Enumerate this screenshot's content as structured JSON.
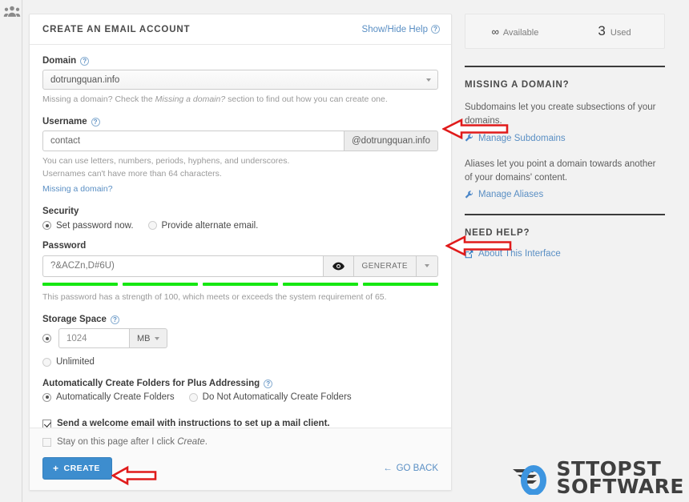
{
  "window": {
    "top_left_icon": "users-group-icon"
  },
  "card": {
    "title": "CREATE AN EMAIL ACCOUNT",
    "help_link": "Show/Hide Help",
    "help_icon": "question-circle-icon"
  },
  "domain": {
    "label": "Domain",
    "help_icon": "question-circle-icon",
    "selected": "dotrungquan.info",
    "caret_icon": "chevron-down-icon",
    "hint_prefix": "Missing a domain? Check the ",
    "hint_italic": "Missing a domain?",
    "hint_suffix": " section to find out how you can create one."
  },
  "username": {
    "label": "Username",
    "help_icon": "question-circle-icon",
    "value": "contact",
    "placeholder": "contact",
    "addon": "@dotrungquan.info",
    "hint_line1": "You can use letters, numbers, periods, hyphens, and underscores.",
    "hint_line2": "Usernames can't have more than 64 characters.",
    "missing_domain_link": "Missing a domain?"
  },
  "security": {
    "title": "Security",
    "options": [
      {
        "label": "Set password now.",
        "selected": true
      },
      {
        "label": "Provide alternate email.",
        "selected": false
      }
    ]
  },
  "password": {
    "label": "Password",
    "value": "?&ACZn,D#6U)",
    "placeholder": "Password",
    "eye_icon": "eye-icon",
    "generate_label": "GENERATE",
    "caret_icon": "chevron-down-icon",
    "strength_segments": 5,
    "strength_color": "#15e712",
    "strength_text": "This password has a strength of 100, which meets or exceeds the system requirement of 65."
  },
  "storage": {
    "label": "Storage Space",
    "help_icon": "question-circle-icon",
    "quota_selected": true,
    "value": "1024",
    "unit": "MB",
    "unit_caret_icon": "chevron-down-icon",
    "unlimited_label": "Unlimited",
    "unlimited_selected": false
  },
  "plus_addressing": {
    "label": "Automatically Create Folders for Plus Addressing",
    "help_icon": "question-circle-icon",
    "options": [
      {
        "label": "Automatically Create Folders",
        "selected": true
      },
      {
        "label": "Do Not Automatically Create Folders",
        "selected": false
      }
    ]
  },
  "welcome_email": {
    "label": "Send a welcome email with instructions to set up a mail client.",
    "checked": true
  },
  "footer": {
    "stay_prefix": "Stay on this page after I click ",
    "stay_italic": "Create",
    "stay_suffix": ".",
    "stay_checked": false,
    "create_label": "CREATE",
    "create_icon": "plus-icon",
    "create_color": "#3d8dce",
    "go_back_label": "GO BACK",
    "go_back_icon": "arrow-left-icon"
  },
  "sidebar": {
    "stats": {
      "available_value": "∞",
      "available_label": "Available",
      "used_value": "3",
      "used_label": "Used"
    },
    "missing_domain": {
      "heading": "MISSING A DOMAIN?",
      "paragraph1": "Subdomains let you create subsections of your domains.",
      "link1": "Manage Subdomains",
      "link1_icon": "wrench-icon",
      "paragraph2": "Aliases let you point a domain towards another of your domains' content.",
      "link2": "Manage Aliases",
      "link2_icon": "wrench-icon"
    },
    "need_help": {
      "heading": "NEED HELP?",
      "link": "About This Interface",
      "link_icon": "external-link-icon"
    }
  },
  "watermark": {
    "line1": "STTOPST",
    "line2": "SOFTWARE",
    "logo_icon": "ring-swoosh-logo",
    "accent_color": "#3d95e0"
  },
  "annotations": {
    "arrow_color": "#e01b1b",
    "arrows": [
      {
        "name": "arrow-username-addon"
      },
      {
        "name": "arrow-password-dropdown"
      },
      {
        "name": "arrow-create-button"
      }
    ]
  }
}
